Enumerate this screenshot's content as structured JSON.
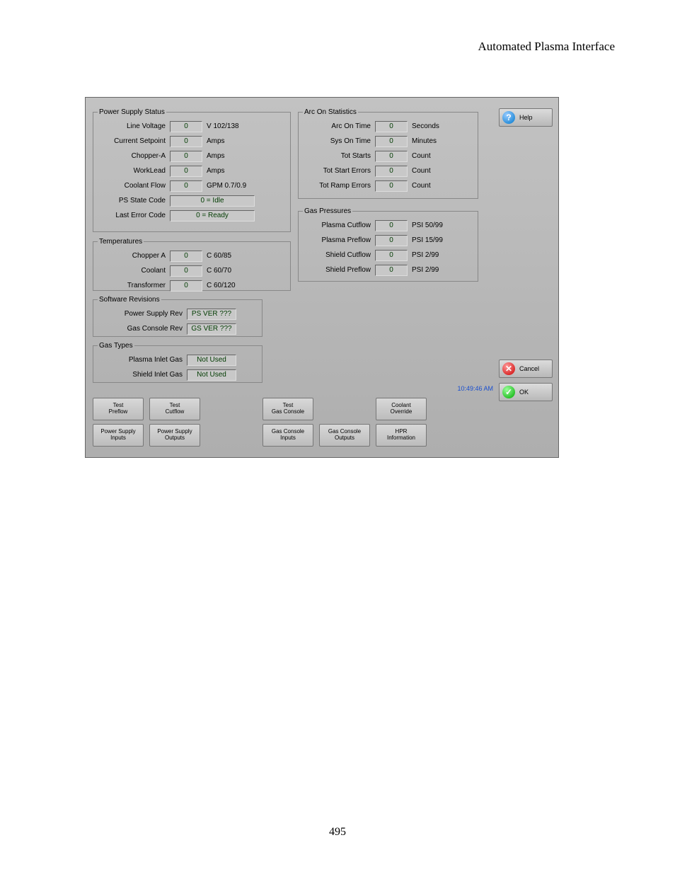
{
  "page": {
    "header": "Automated Plasma Interface",
    "number": "495"
  },
  "power_supply_status": {
    "legend": "Power Supply Status",
    "line_voltage": {
      "label": "Line Voltage",
      "value": "0",
      "unit": "V 102/138"
    },
    "current_setpoint": {
      "label": "Current Setpoint",
      "value": "0",
      "unit": "Amps"
    },
    "chopper_a": {
      "label": "Chopper-A",
      "value": "0",
      "unit": "Amps"
    },
    "worklead": {
      "label": "WorkLead",
      "value": "0",
      "unit": "Amps"
    },
    "coolant_flow": {
      "label": "Coolant Flow",
      "value": "0",
      "unit": "GPM 0.7/0.9"
    },
    "ps_state_code": {
      "label": "PS State Code",
      "value": "0 = Idle"
    },
    "last_error_code": {
      "label": "Last Error Code",
      "value": "0 = Ready"
    }
  },
  "temperatures": {
    "legend": "Temperatures",
    "chopper_a": {
      "label": "Chopper A",
      "value": "0",
      "unit": "C 60/85"
    },
    "coolant": {
      "label": "Coolant",
      "value": "0",
      "unit": "C 60/70"
    },
    "transformer": {
      "label": "Transformer",
      "value": "0",
      "unit": "C 60/120"
    }
  },
  "software_revisions": {
    "legend": "Software Revisions",
    "ps_rev": {
      "label": "Power Supply Rev",
      "value": "PS VER ???"
    },
    "gc_rev": {
      "label": "Gas Console Rev",
      "value": "GS VER ???"
    }
  },
  "gas_types": {
    "legend": "Gas Types",
    "plasma_inlet": {
      "label": "Plasma Inlet Gas",
      "value": "Not Used"
    },
    "shield_inlet": {
      "label": "Shield Inlet Gas",
      "value": "Not Used"
    }
  },
  "arc_on_stats": {
    "legend": "Arc On Statistics",
    "arc_on_time": {
      "label": "Arc On Time",
      "value": "0",
      "unit": "Seconds"
    },
    "sys_on_time": {
      "label": "Sys On Time",
      "value": "0",
      "unit": "Minutes"
    },
    "tot_starts": {
      "label": "Tot Starts",
      "value": "0",
      "unit": "Count"
    },
    "tot_start_errors": {
      "label": "Tot Start Errors",
      "value": "0",
      "unit": "Count"
    },
    "tot_ramp_errors": {
      "label": "Tot Ramp Errors",
      "value": "0",
      "unit": "Count"
    }
  },
  "gas_pressures": {
    "legend": "Gas Pressures",
    "plasma_cutflow": {
      "label": "Plasma Cutflow",
      "value": "0",
      "unit": "PSI 50/99"
    },
    "plasma_preflow": {
      "label": "Plasma Preflow",
      "value": "0",
      "unit": "PSI 15/99"
    },
    "shield_cutflow": {
      "label": "Shield Cutflow",
      "value": "0",
      "unit": "PSI 2/99"
    },
    "shield_preflow": {
      "label": "Shield Preflow",
      "value": "0",
      "unit": "PSI 2/99"
    }
  },
  "timestamp": "10:49:46 AM",
  "buttons": {
    "row1": [
      "Test\nPreflow",
      "Test\nCutflow",
      "",
      "Test\nGas Console",
      "",
      "Coolant\nOverride"
    ],
    "row2": [
      "Power Supply\nInputs",
      "Power Supply\nOutputs",
      "",
      "Gas Console\nInputs",
      "Gas Console\nOutputs",
      "HPR\nInformation"
    ]
  },
  "right_buttons": {
    "help": "Help",
    "cancel": "Cancel",
    "ok": "OK"
  }
}
